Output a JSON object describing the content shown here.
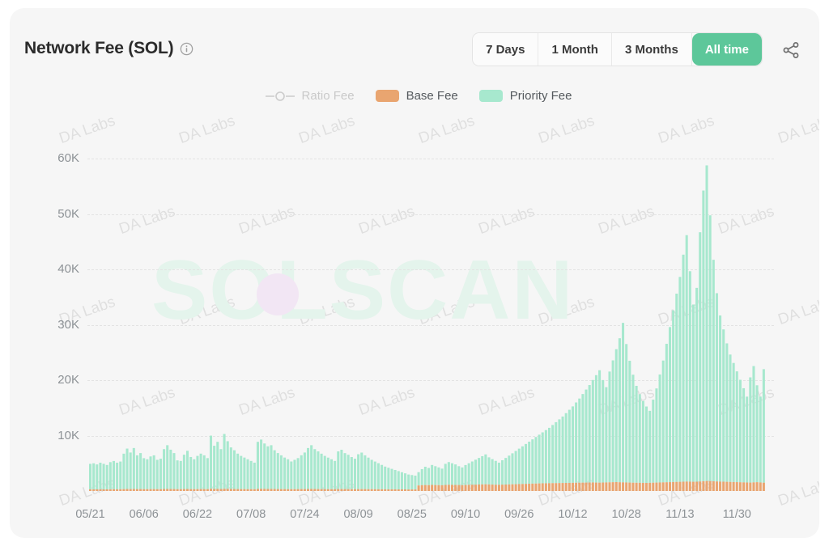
{
  "card": {
    "background": "#f6f6f6"
  },
  "header": {
    "title": "Network Fee (SOL)",
    "info_icon": "info-circle-icon",
    "share_icon": "share-icon",
    "ranges": [
      {
        "label": "7 Days",
        "active": false
      },
      {
        "label": "1 Month",
        "active": false
      },
      {
        "label": "3 Months",
        "active": false
      },
      {
        "label": "All time",
        "active": true
      }
    ],
    "active_color": "#5dc79a"
  },
  "legend": [
    {
      "label": "Ratio Fee",
      "marker": "line-with-circle-marker",
      "color": "#c9c9c9",
      "disabled": true
    },
    {
      "label": "Base Fee",
      "marker": "swatch",
      "color": "#e9a570",
      "disabled": false
    },
    {
      "label": "Priority Fee",
      "marker": "swatch",
      "color": "#a7e8ce",
      "disabled": false
    }
  ],
  "watermark": {
    "brand": "SOLSCAN",
    "tile": "DA Labs"
  },
  "chart_data": {
    "type": "bar",
    "stacked": true,
    "title": "Network Fee (SOL)",
    "xlabel": "",
    "ylabel": "",
    "grid": true,
    "legend_position": "top-center",
    "ylim": [
      0,
      65000
    ],
    "yticks": [
      10000,
      20000,
      30000,
      40000,
      50000,
      60000
    ],
    "ytick_labels": [
      "10K",
      "20K",
      "30K",
      "40K",
      "50K",
      "60K"
    ],
    "xtick_labels": [
      "05/21",
      "06/06",
      "06/22",
      "07/08",
      "07/24",
      "08/09",
      "08/25",
      "09/10",
      "09/26",
      "10/12",
      "10/28",
      "11/13",
      "11/30"
    ],
    "xtick_indices": [
      0,
      16,
      32,
      48,
      64,
      80,
      96,
      112,
      128,
      144,
      160,
      176,
      193
    ],
    "colors": {
      "base_fee": "#e9a570",
      "priority_fee": "#a7e8ce"
    },
    "series": [
      {
        "name": "Priority Fee",
        "color": "#a7e8ce",
        "values": [
          4600,
          4700,
          4500,
          4800,
          4600,
          4400,
          4900,
          5100,
          4800,
          5000,
          6400,
          7300,
          6600,
          7400,
          6100,
          6500,
          5600,
          5400,
          5900,
          6100,
          5300,
          5500,
          7200,
          7900,
          7100,
          6500,
          5200,
          5100,
          6200,
          6900,
          5800,
          5400,
          6000,
          6400,
          6100,
          5600,
          9600,
          7800,
          8500,
          7200,
          9900,
          8600,
          7500,
          7000,
          6400,
          6000,
          5700,
          5400,
          5100,
          4800,
          8500,
          8900,
          8200,
          7700,
          7900,
          7000,
          6500,
          6100,
          5700,
          5400,
          5000,
          5300,
          5600,
          6100,
          6600,
          7400,
          7900,
          7200,
          6800,
          6400,
          6000,
          5700,
          5400,
          5100,
          6800,
          7100,
          6500,
          6200,
          5800,
          5500,
          6300,
          6600,
          6100,
          5700,
          5300,
          5000,
          4700,
          4400,
          4100,
          3900,
          3700,
          3500,
          3300,
          3100,
          2900,
          2700,
          2600,
          2500,
          2400,
          2900,
          3300,
          3100,
          3600,
          3400,
          3200,
          3000,
          3800,
          4100,
          3900,
          3700,
          3400,
          3200,
          3600,
          3900,
          4200,
          4500,
          4800,
          5100,
          5400,
          4900,
          4600,
          4300,
          4000,
          4400,
          4800,
          5200,
          5600,
          6000,
          6400,
          6800,
          7200,
          7600,
          8000,
          8400,
          8800,
          9200,
          9600,
          10000,
          10500,
          11000,
          11500,
          12000,
          12600,
          13200,
          13800,
          14500,
          15200,
          16000,
          16800,
          17600,
          18500,
          19400,
          20300,
          18500,
          17200,
          20000,
          22000,
          24000,
          26000,
          28800,
          25000,
          22000,
          19500,
          17500,
          16000,
          14800,
          13800,
          13000,
          15000,
          17000,
          19500,
          22000,
          25000,
          28000,
          31000,
          34000,
          37000,
          41000,
          44500,
          38000,
          32000,
          35000,
          45000,
          52500,
          57000,
          48000,
          40000,
          34000,
          30000,
          27500,
          25000,
          23000,
          21500,
          20000,
          18500,
          17000,
          15500,
          19000,
          21000,
          17500,
          15500,
          20500
        ]
      },
      {
        "name": "Base Fee",
        "color": "#e9a570",
        "values": [
          300,
          300,
          300,
          310,
          300,
          300,
          310,
          320,
          310,
          320,
          340,
          360,
          350,
          360,
          340,
          350,
          330,
          330,
          340,
          340,
          330,
          330,
          360,
          370,
          360,
          350,
          330,
          330,
          350,
          360,
          340,
          330,
          340,
          350,
          340,
          340,
          400,
          370,
          380,
          360,
          400,
          390,
          370,
          360,
          350,
          340,
          340,
          330,
          330,
          320,
          380,
          390,
          380,
          370,
          370,
          360,
          350,
          340,
          340,
          330,
          330,
          330,
          340,
          350,
          350,
          360,
          370,
          360,
          350,
          340,
          340,
          330,
          330,
          330,
          350,
          350,
          340,
          340,
          330,
          330,
          340,
          340,
          340,
          330,
          330,
          320,
          320,
          310,
          310,
          300,
          300,
          300,
          290,
          290,
          290,
          280,
          280,
          280,
          1000,
          1050,
          1080,
          1060,
          1100,
          1080,
          1060,
          1040,
          1100,
          1120,
          1110,
          1100,
          1080,
          1060,
          1090,
          1110,
          1130,
          1150,
          1170,
          1190,
          1210,
          1180,
          1160,
          1140,
          1120,
          1150,
          1170,
          1190,
          1210,
          1230,
          1250,
          1270,
          1290,
          1310,
          1330,
          1350,
          1370,
          1390,
          1400,
          1410,
          1420,
          1430,
          1440,
          1450,
          1460,
          1470,
          1480,
          1490,
          1500,
          1510,
          1520,
          1530,
          1540,
          1520,
          1510,
          1530,
          1550,
          1570,
          1590,
          1610,
          1580,
          1560,
          1540,
          1520,
          1500,
          1490,
          1480,
          1470,
          1460,
          1480,
          1500,
          1520,
          1540,
          1560,
          1580,
          1600,
          1620,
          1640,
          1660,
          1680,
          1700,
          1690,
          1670,
          1680,
          1720,
          1760,
          1800,
          1780,
          1750,
          1720,
          1700,
          1680,
          1660,
          1640,
          1620,
          1600,
          1580,
          1560,
          1540,
          1520,
          1560,
          1590,
          1540,
          1500,
          1580
        ]
      }
    ],
    "peak": {
      "value": 57000,
      "index": 186,
      "label": "11/13"
    }
  }
}
